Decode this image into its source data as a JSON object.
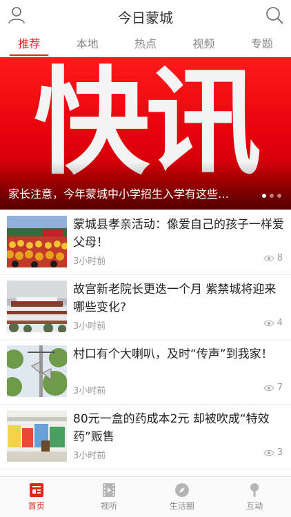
{
  "header": {
    "title": "今日蒙城",
    "user_icon": "user-icon",
    "search_icon": "search-icon"
  },
  "tabs": [
    {
      "label": "推荐",
      "active": true
    },
    {
      "label": "本地",
      "active": false
    },
    {
      "label": "热点",
      "active": false
    },
    {
      "label": "视频",
      "active": false
    },
    {
      "label": "专题",
      "active": false
    }
  ],
  "banner": {
    "big_text": "快讯",
    "caption": "家长注意，今年蒙城中小学招生入学有这些…",
    "slide_count": 3,
    "active_slide": 1
  },
  "articles": [
    {
      "title": "蒙城县孝亲活动：像爱自己的孩子一样爱父母！",
      "time": "3小时前",
      "views": "8"
    },
    {
      "title": "故宫新老院长更迭一个月 紫禁城将迎来哪些变化?",
      "time": "3小时前",
      "views": "4"
    },
    {
      "title": "村口有个大喇叭，及时“传声”到我家！",
      "time": "3小时前",
      "views": "7"
    },
    {
      "title": "80元一盒的药成本2元 却被吹成“特效药”贩售",
      "time": "3小时前",
      "views": "3"
    }
  ],
  "tabbar": [
    {
      "label": "首页",
      "icon": "news-icon",
      "active": true
    },
    {
      "label": "视听",
      "icon": "film-icon",
      "active": false
    },
    {
      "label": "生活圈",
      "icon": "compass-icon",
      "active": false
    },
    {
      "label": "互动",
      "icon": "microphone-icon",
      "active": false
    }
  ],
  "colors": {
    "accent": "#e0251b",
    "banner_red": "#e3000b"
  }
}
